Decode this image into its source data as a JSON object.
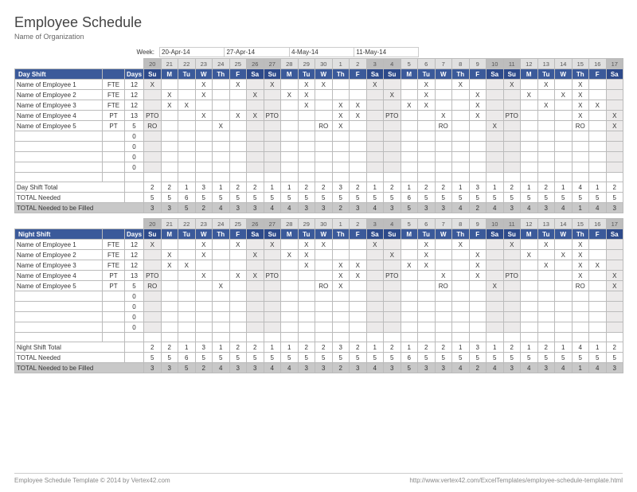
{
  "title": "Employee Schedule",
  "subtitle": "Name of Organization",
  "weekLabel": "Week:",
  "weekDates": [
    "20-Apr-14",
    "27-Apr-14",
    "4-May-14",
    "11-May-14"
  ],
  "dayNums": [
    "20",
    "21",
    "22",
    "23",
    "24",
    "25",
    "26",
    "27",
    "28",
    "29",
    "30",
    "1",
    "2",
    "3",
    "4",
    "5",
    "6",
    "7",
    "8",
    "9",
    "10",
    "11",
    "12",
    "13",
    "14",
    "15",
    "16",
    "17"
  ],
  "dow": [
    "Su",
    "M",
    "Tu",
    "W",
    "Th",
    "F",
    "Sa",
    "Su",
    "M",
    "Tu",
    "W",
    "Th",
    "F",
    "Sa",
    "Su",
    "M",
    "Tu",
    "W",
    "Th",
    "F",
    "Sa",
    "Su",
    "M",
    "Tu",
    "W",
    "Th",
    "F",
    "Sa"
  ],
  "weekendIdx": [
    0,
    6,
    7,
    13,
    14,
    20,
    21,
    27
  ],
  "sections": [
    {
      "name": "Day Shift",
      "daysHdr": "Days",
      "employees": [
        {
          "name": "Name of Employee 1",
          "type": "FTE",
          "days": "12",
          "cells": [
            "X",
            "",
            "",
            "X",
            "",
            "X",
            "",
            "X",
            "",
            "X",
            "X",
            "",
            "",
            "X",
            "",
            "",
            "X",
            "",
            "X",
            "",
            "",
            "X",
            "",
            "X",
            "",
            "X",
            "",
            ""
          ]
        },
        {
          "name": "Name of Employee 2",
          "type": "FTE",
          "days": "12",
          "cells": [
            "",
            "X",
            "",
            "X",
            "",
            "",
            "X",
            "",
            "X",
            "X",
            "",
            "",
            "",
            "",
            "X",
            "",
            "X",
            "",
            "",
            "X",
            "",
            "",
            "X",
            "",
            "X",
            "X",
            "",
            ""
          ]
        },
        {
          "name": "Name of Employee 3",
          "type": "FTE",
          "days": "12",
          "cells": [
            "",
            "X",
            "X",
            "",
            "",
            "",
            "",
            "",
            "",
            "X",
            "",
            "X",
            "X",
            "",
            "",
            "X",
            "X",
            "",
            "",
            "X",
            "",
            "",
            "",
            "X",
            "",
            "X",
            "X",
            ""
          ]
        },
        {
          "name": "Name of Employee 4",
          "type": "PT",
          "days": "13",
          "cells": [
            "PTO",
            "",
            "",
            "X",
            "",
            "X",
            "X",
            "PTO",
            "",
            "",
            "",
            "X",
            "X",
            "",
            "PTO",
            "",
            "",
            "X",
            "",
            "X",
            "",
            "PTO",
            "",
            "",
            "",
            "X",
            "",
            "X"
          ]
        },
        {
          "name": "Name of Employee 5",
          "type": "PT",
          "days": "5",
          "cells": [
            "RO",
            "",
            "",
            "",
            "X",
            "",
            "",
            "",
            "",
            "",
            "RO",
            "X",
            "",
            "",
            "",
            "",
            "",
            "RO",
            "",
            "",
            "X",
            "",
            "",
            "",
            "",
            "RO",
            "",
            "X"
          ]
        }
      ],
      "emptyRows": 4,
      "totals": [
        {
          "label": "Day Shift Total",
          "cells": [
            "2",
            "2",
            "1",
            "3",
            "1",
            "2",
            "2",
            "1",
            "1",
            "2",
            "2",
            "3",
            "2",
            "1",
            "2",
            "1",
            "2",
            "2",
            "1",
            "3",
            "1",
            "2",
            "1",
            "2",
            "1",
            "4",
            "1",
            "2"
          ]
        },
        {
          "label": "TOTAL Needed",
          "cells": [
            "5",
            "5",
            "6",
            "5",
            "5",
            "5",
            "5",
            "5",
            "5",
            "5",
            "5",
            "5",
            "5",
            "5",
            "5",
            "6",
            "5",
            "5",
            "5",
            "5",
            "5",
            "5",
            "5",
            "5",
            "5",
            "5",
            "5",
            "5"
          ]
        }
      ],
      "fill": {
        "label": "TOTAL Needed to be Filled",
        "cells": [
          "3",
          "3",
          "5",
          "2",
          "4",
          "3",
          "3",
          "4",
          "4",
          "3",
          "3",
          "2",
          "3",
          "4",
          "3",
          "5",
          "3",
          "3",
          "4",
          "2",
          "4",
          "3",
          "4",
          "3",
          "4",
          "1",
          "4",
          "3"
        ]
      }
    },
    {
      "name": "Night Shift",
      "daysHdr": "Days",
      "employees": [
        {
          "name": "Name of Employee 1",
          "type": "FTE",
          "days": "12",
          "cells": [
            "X",
            "",
            "",
            "X",
            "",
            "X",
            "",
            "X",
            "",
            "X",
            "X",
            "",
            "",
            "X",
            "",
            "",
            "X",
            "",
            "X",
            "",
            "",
            "X",
            "",
            "X",
            "",
            "X",
            "",
            ""
          ]
        },
        {
          "name": "Name of Employee 2",
          "type": "FTE",
          "days": "12",
          "cells": [
            "",
            "X",
            "",
            "X",
            "",
            "",
            "X",
            "",
            "X",
            "X",
            "",
            "",
            "",
            "",
            "X",
            "",
            "X",
            "",
            "",
            "X",
            "",
            "",
            "X",
            "",
            "X",
            "X",
            "",
            ""
          ]
        },
        {
          "name": "Name of Employee 3",
          "type": "FTE",
          "days": "12",
          "cells": [
            "",
            "X",
            "X",
            "",
            "",
            "",
            "",
            "",
            "",
            "X",
            "",
            "X",
            "X",
            "",
            "",
            "X",
            "X",
            "",
            "",
            "X",
            "",
            "",
            "",
            "X",
            "",
            "X",
            "X",
            ""
          ]
        },
        {
          "name": "Name of Employee 4",
          "type": "PT",
          "days": "13",
          "cells": [
            "PTO",
            "",
            "",
            "X",
            "",
            "X",
            "X",
            "PTO",
            "",
            "",
            "",
            "X",
            "X",
            "",
            "PTO",
            "",
            "",
            "X",
            "",
            "X",
            "",
            "PTO",
            "",
            "",
            "",
            "X",
            "",
            "X"
          ]
        },
        {
          "name": "Name of Employee 5",
          "type": "PT",
          "days": "5",
          "cells": [
            "RO",
            "",
            "",
            "",
            "X",
            "",
            "",
            "",
            "",
            "",
            "RO",
            "X",
            "",
            "",
            "",
            "",
            "",
            "RO",
            "",
            "",
            "X",
            "",
            "",
            "",
            "",
            "RO",
            "",
            "X"
          ]
        }
      ],
      "emptyRows": 4,
      "totals": [
        {
          "label": "Night Shift Total",
          "cells": [
            "2",
            "2",
            "1",
            "3",
            "1",
            "2",
            "2",
            "1",
            "1",
            "2",
            "2",
            "3",
            "2",
            "1",
            "2",
            "1",
            "2",
            "2",
            "1",
            "3",
            "1",
            "2",
            "1",
            "2",
            "1",
            "4",
            "1",
            "2"
          ]
        },
        {
          "label": "TOTAL Needed",
          "cells": [
            "5",
            "5",
            "6",
            "5",
            "5",
            "5",
            "5",
            "5",
            "5",
            "5",
            "5",
            "5",
            "5",
            "5",
            "5",
            "6",
            "5",
            "5",
            "5",
            "5",
            "5",
            "5",
            "5",
            "5",
            "5",
            "5",
            "5",
            "5"
          ]
        }
      ],
      "fill": {
        "label": "TOTAL Needed to be Filled",
        "cells": [
          "3",
          "3",
          "5",
          "2",
          "4",
          "3",
          "3",
          "4",
          "4",
          "3",
          "3",
          "2",
          "3",
          "4",
          "3",
          "5",
          "3",
          "3",
          "4",
          "2",
          "4",
          "3",
          "4",
          "3",
          "4",
          "1",
          "4",
          "3"
        ]
      }
    }
  ],
  "footer": {
    "left": "Employee Schedule Template © 2014 by Vertex42.com",
    "right": "http://www.vertex42.com/ExcelTemplates/employee-schedule-template.html"
  }
}
